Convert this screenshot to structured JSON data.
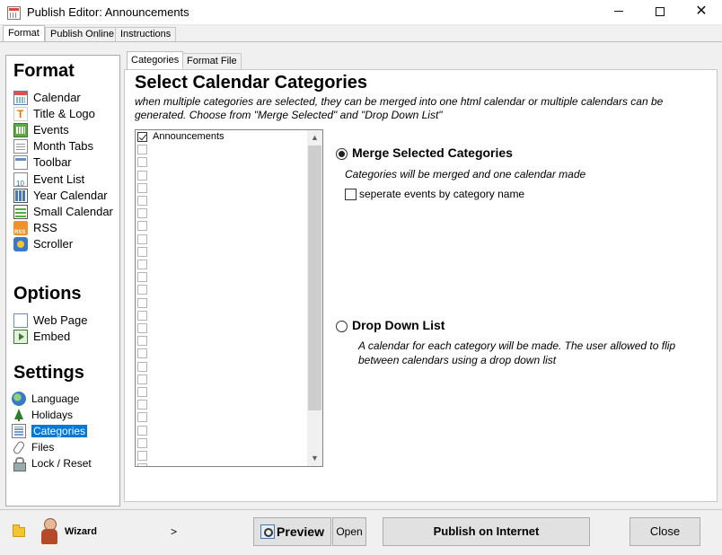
{
  "window": {
    "title": "Publish Editor: Announcements"
  },
  "main_tabs": [
    "Format",
    "Publish Online",
    "Instructions"
  ],
  "sidebar": {
    "format_heading": "Format",
    "format_items": [
      "Calendar",
      "Title & Logo",
      "Events",
      "Month Tabs",
      "Toolbar",
      "Event List",
      "Year Calendar",
      "Small Calendar",
      "RSS",
      "Scroller"
    ],
    "options_heading": "Options",
    "options_items": [
      "Web Page",
      "Embed"
    ],
    "settings_heading": "Settings",
    "settings_items": [
      "Language",
      "Holidays",
      "Categories",
      "Files",
      "Lock / Reset"
    ],
    "selected_item": "Categories"
  },
  "sub_tabs": [
    "Categories",
    "Format File"
  ],
  "main": {
    "title": "Select Calendar Categories",
    "description": "when multiple categories are selected, they can be merged into one html calendar or multiple calendars can be generated. Choose from \"Merge Selected\" and \"Drop Down List\"",
    "categories": [
      {
        "label": "Announcements",
        "checked": true
      }
    ],
    "empty_rows": 26,
    "merge": {
      "label": "Merge Selected Categories",
      "selected": true,
      "description": "Categories will be merged and one calendar made",
      "checkbox_label": "seperate events by category name",
      "checkbox_checked": false
    },
    "dropdown": {
      "label": "Drop Down List",
      "selected": false,
      "description": "A calendar for each category will be made.  The user allowed to flip between calendars using a drop down list"
    }
  },
  "bottom": {
    "wizard_label": "Wizard",
    "wizard_arrow": ">",
    "preview_label": "Preview",
    "open_label": "Open",
    "publish_label": "Publish on Internet",
    "close_label": "Close"
  }
}
